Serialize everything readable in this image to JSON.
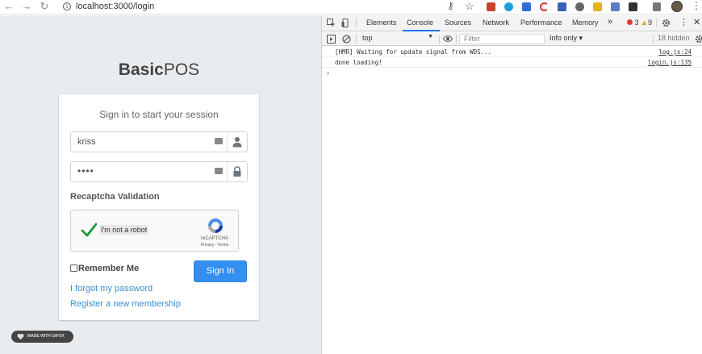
{
  "browser": {
    "url": "localhost:3000/login"
  },
  "page": {
    "logo_bold": "Basic",
    "logo_light": "POS",
    "card_message": "Sign in to start your session",
    "username_value": "kriss",
    "password_value": "••••",
    "recaptcha_section_title": "Recaptcha Validation",
    "captcha_label": "I'm not a robot",
    "captcha_brand": "reCAPTCHA",
    "captcha_terms": "Privacy - Terms",
    "remember_label": "Remember Me",
    "signin_label": "Sign In",
    "forgot_link": "I forgot my password",
    "register_link": "Register a new membership",
    "badge": "MADE WITH GIFOX"
  },
  "devtools": {
    "tabs": [
      "Elements",
      "Console",
      "Sources",
      "Network",
      "Performance",
      "Memory"
    ],
    "more_tabs": "»",
    "active_tab": "Console",
    "errors": "3",
    "warnings": "9",
    "context": "top",
    "filter_placeholder": "Filter",
    "level": "Info only ▾",
    "hidden": "18 hidden",
    "logs": [
      {
        "message": "[HMR] Waiting for update signal from WDS...",
        "source": "log.js:24"
      },
      {
        "message": "done loading!",
        "source": "login.js:135"
      }
    ],
    "prompt": "›"
  },
  "colors": {
    "accent": "#3490f0",
    "link": "#3b8fd1",
    "page_bg": "#e9ecef"
  }
}
